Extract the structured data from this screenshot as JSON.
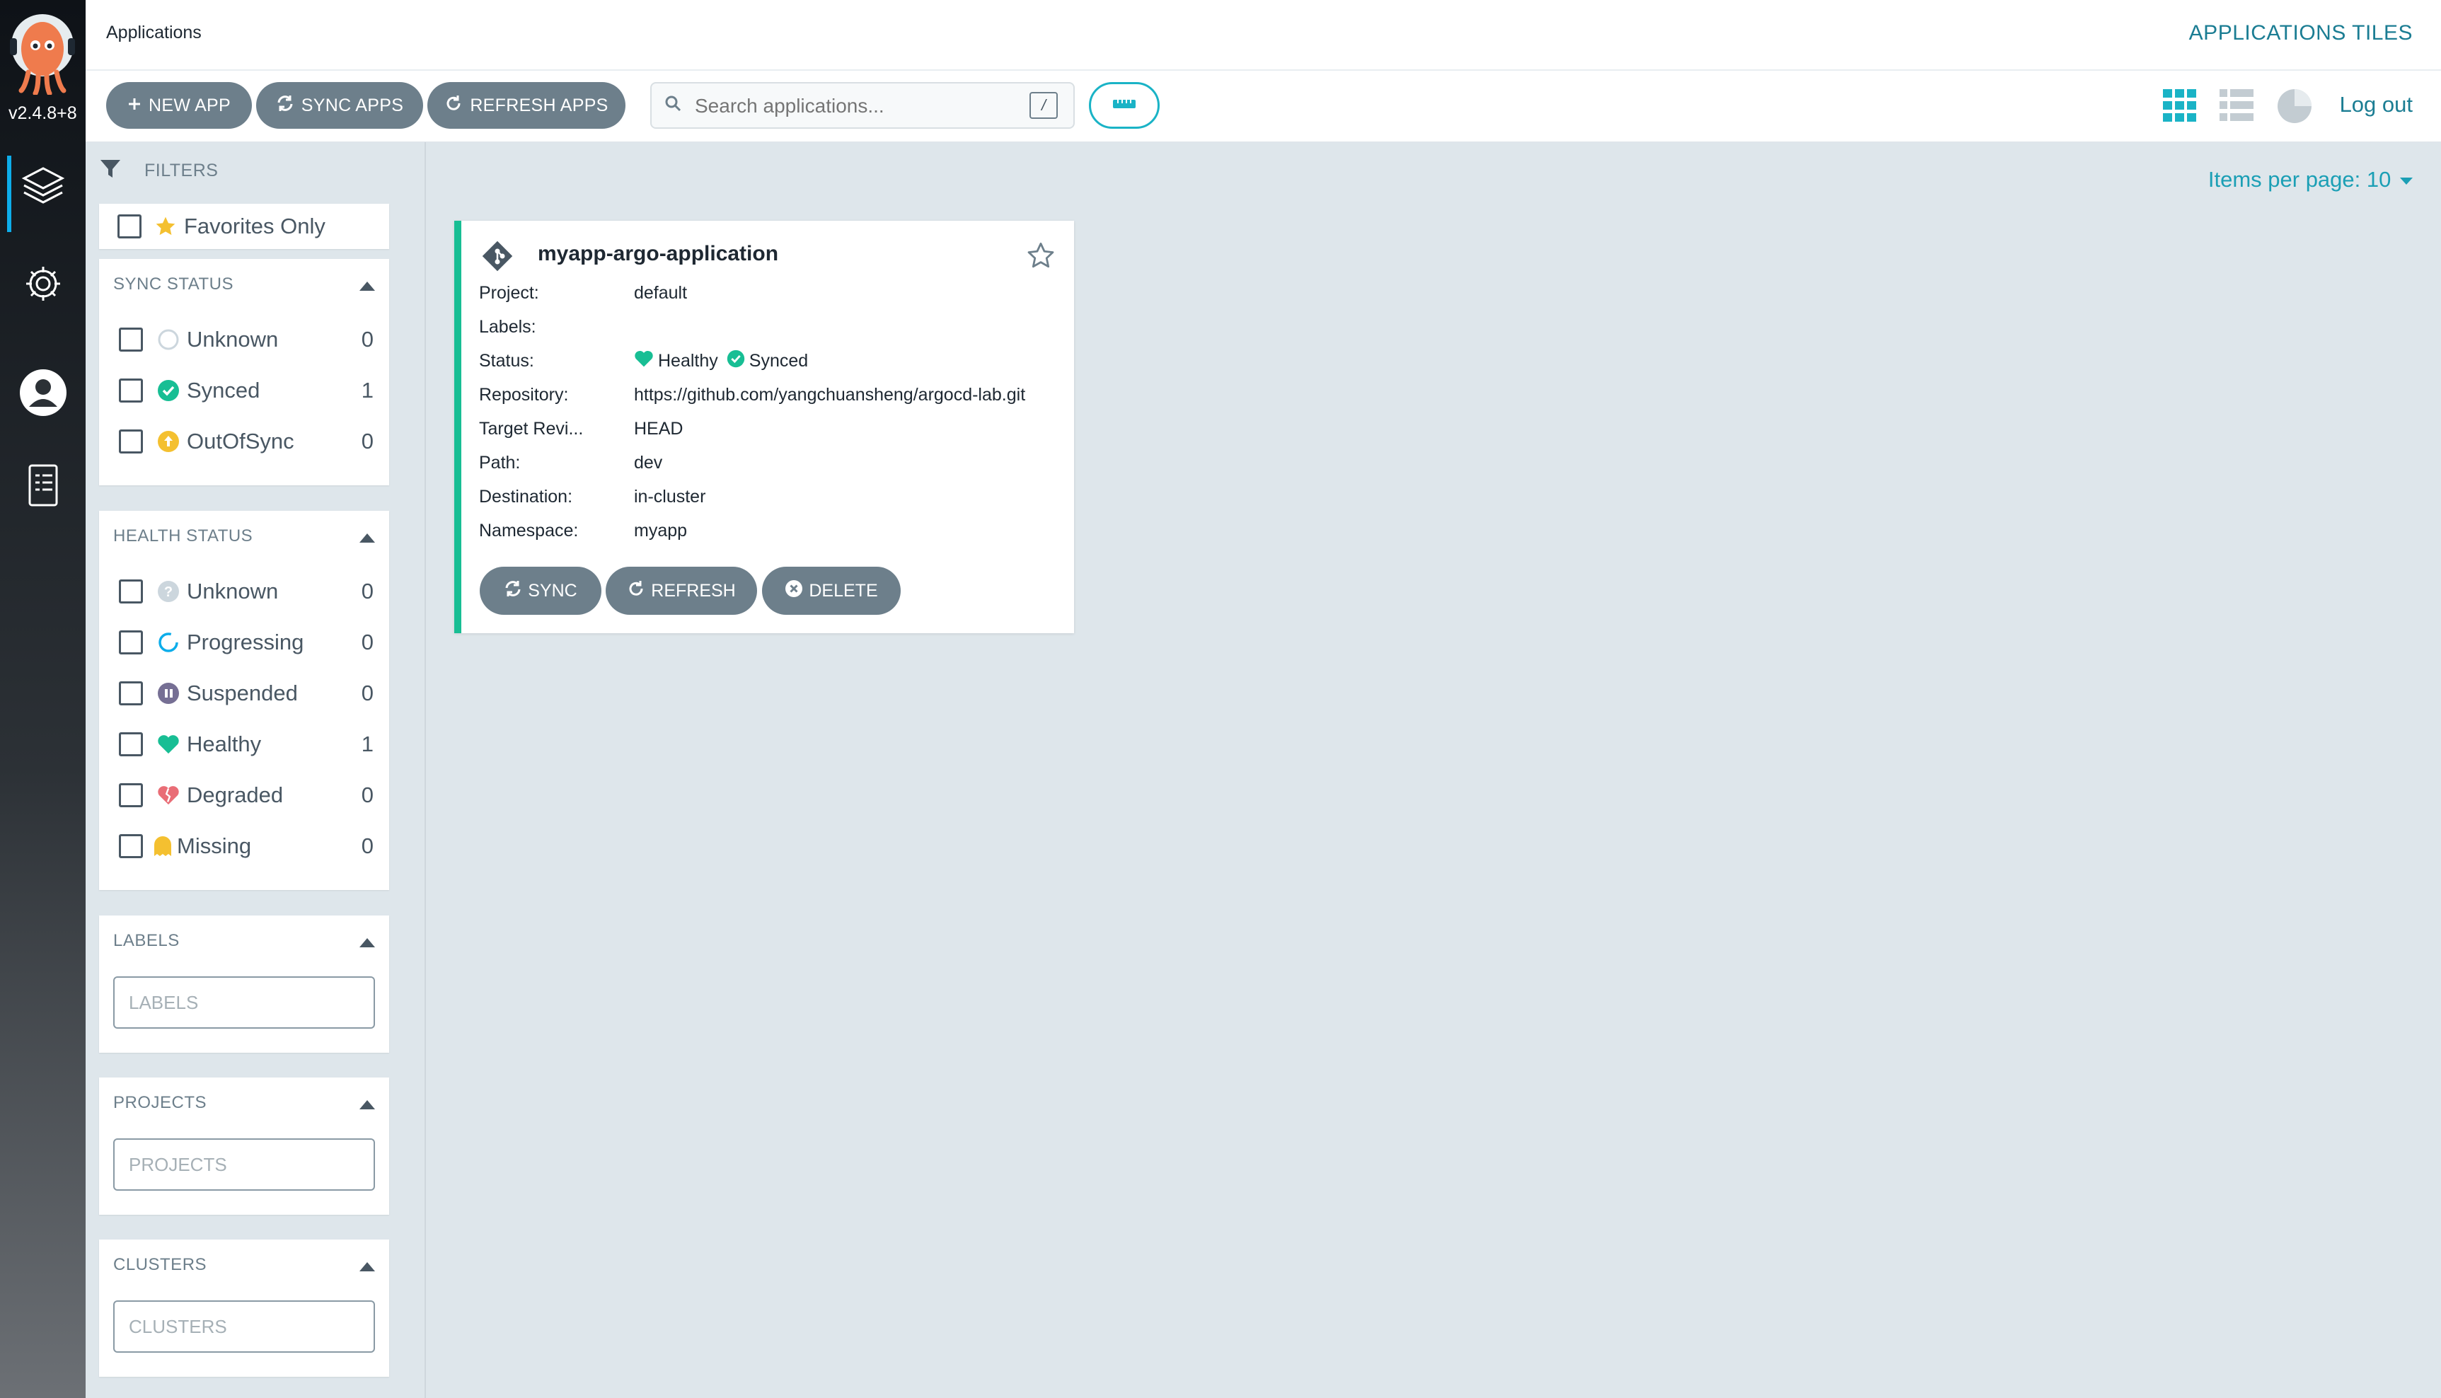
{
  "nav": {
    "version": "v2.4.8+8",
    "items": [
      {
        "name": "applications",
        "icon": "layers-icon"
      },
      {
        "name": "settings",
        "icon": "gear-icon"
      },
      {
        "name": "user-info",
        "icon": "user-icon"
      },
      {
        "name": "documentation",
        "icon": "docs-icon"
      }
    ]
  },
  "header": {
    "title": "Applications",
    "view_title": "APPLICATIONS TILES",
    "logout": "Log out"
  },
  "toolbar": {
    "new_app": "NEW APP",
    "sync_apps": "SYNC APPS",
    "refresh_apps": "REFRESH APPS",
    "search_placeholder": "Search applications...",
    "search_shortcut": "/",
    "views": [
      "tiles-view-icon",
      "list-view-icon",
      "summary-view-icon"
    ]
  },
  "filters": {
    "label": "FILTERS",
    "favorites_label": "Favorites Only",
    "sync_status": {
      "title": "SYNC STATUS",
      "items": [
        {
          "label": "Unknown",
          "count": "0"
        },
        {
          "label": "Synced",
          "count": "1"
        },
        {
          "label": "OutOfSync",
          "count": "0"
        }
      ]
    },
    "health_status": {
      "title": "HEALTH STATUS",
      "items": [
        {
          "label": "Unknown",
          "count": "0"
        },
        {
          "label": "Progressing",
          "count": "0"
        },
        {
          "label": "Suspended",
          "count": "0"
        },
        {
          "label": "Healthy",
          "count": "1"
        },
        {
          "label": "Degraded",
          "count": "0"
        },
        {
          "label": "Missing",
          "count": "0"
        }
      ]
    },
    "labels": {
      "title": "LABELS",
      "placeholder": "LABELS"
    },
    "projects": {
      "title": "PROJECTS",
      "placeholder": "PROJECTS"
    },
    "clusters": {
      "title": "CLUSTERS",
      "placeholder": "CLUSTERS"
    }
  },
  "pagination": {
    "items_per_page": "Items per page: 10"
  },
  "app": {
    "name": "myapp-argo-application",
    "fields": [
      {
        "key": "Project:",
        "value": "default"
      },
      {
        "key": "Labels:",
        "value": ""
      },
      {
        "key": "Status:",
        "value": ""
      },
      {
        "key": "Repository:",
        "value": "https://github.com/yangchuansheng/argocd-lab.git"
      },
      {
        "key": "Target Revi...",
        "value": "HEAD"
      },
      {
        "key": "Path:",
        "value": "dev"
      },
      {
        "key": "Destination:",
        "value": "in-cluster"
      },
      {
        "key": "Namespace:",
        "value": "myapp"
      }
    ],
    "health": "Healthy",
    "sync": "Synced",
    "buttons": {
      "sync": "SYNC",
      "refresh": "REFRESH",
      "delete": "DELETE"
    }
  },
  "colors": {
    "accent": "#1b7d93",
    "healthy": "#18be94",
    "button": "#6d7f8b",
    "out_of_sync": "#f4c030",
    "degraded": "#e96d76",
    "suspended": "#766f94"
  }
}
